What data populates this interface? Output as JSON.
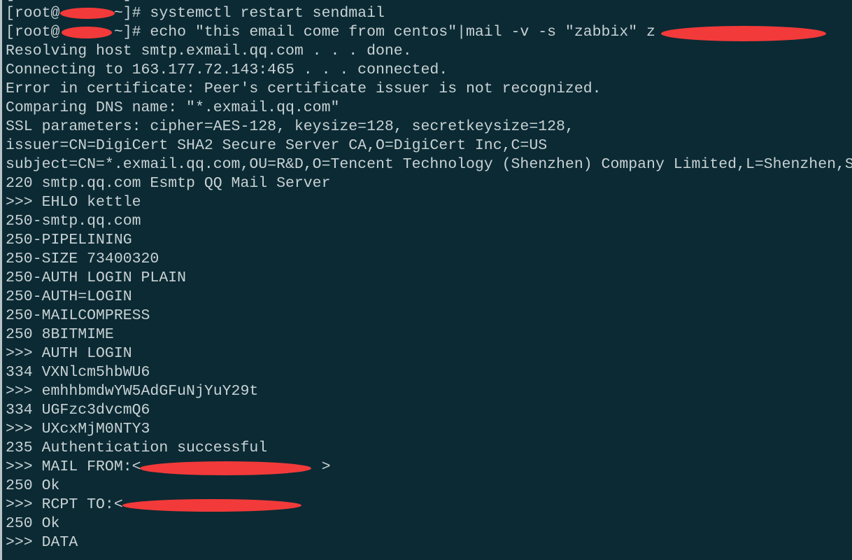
{
  "terminal": {
    "lines": [
      "[root@      ~]# ",
      "[root@      ~]# systemctl restart sendmail",
      "[root@      ~]# echo \"this email come from centos\"|mail -v -s \"zabbix\" z",
      "Resolving host smtp.exmail.qq.com . . . done.",
      "Connecting to 163.177.72.143:465 . . . connected.",
      "Error in certificate: Peer's certificate issuer is not recognized.",
      "Comparing DNS name: \"*.exmail.qq.com\"",
      "SSL parameters: cipher=AES-128, keysize=128, secretkeysize=128,",
      "issuer=CN=DigiCert SHA2 Secure Server CA,O=DigiCert Inc,C=US",
      "subject=CN=*.exmail.qq.com,OU=R&D,O=Tencent Technology (Shenzhen) Company Limited,L=Shenzhen,S",
      "220 smtp.qq.com Esmtp QQ Mail Server",
      ">>> EHLO kettle",
      "250-smtp.qq.com",
      "250-PIPELINING",
      "250-SIZE 73400320",
      "250-AUTH LOGIN PLAIN",
      "250-AUTH=LOGIN",
      "250-MAILCOMPRESS",
      "250 8BITMIME",
      ">>> AUTH LOGIN",
      "334 VXNlcm5hbWU6",
      ">>> emhhbmdwYW5AdGFuNjYuY29t",
      "334 UGFzc3dvcmQ6",
      ">>> UXcxMjM0NTY3",
      "235 Authentication successful",
      ">>> MAIL FROM:<                    >",
      "250 Ok",
      ">>> RCPT TO:<",
      "250 Ok",
      ">>> DATA"
    ]
  },
  "colors": {
    "background": "#0b2a34",
    "text": "#c9d2d4",
    "redaction": "#f23a3a"
  }
}
